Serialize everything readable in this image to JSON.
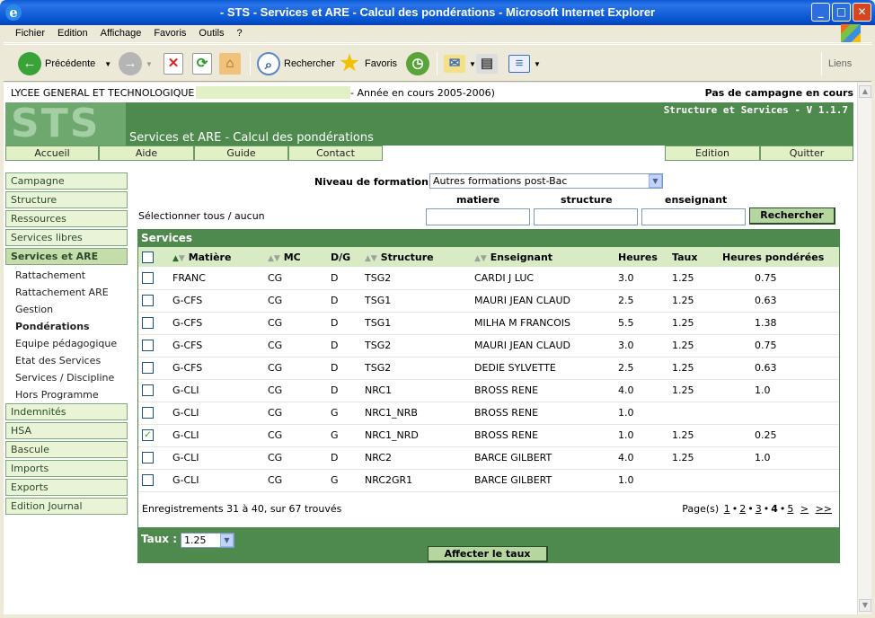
{
  "window": {
    "title": "- STS - Services et ARE - Calcul des pondérations - Microsoft Internet Explorer"
  },
  "menu": [
    "Fichier",
    "Edition",
    "Affichage",
    "Favoris",
    "Outils",
    "?"
  ],
  "toolbar": {
    "back": "Précédente",
    "search": "Rechercher",
    "favorites": "Favoris",
    "links": "Liens"
  },
  "header": {
    "school": "LYCEE GENERAL ET TECHNOLOGIQUE",
    "year": "- Année en cours 2005-2006)",
    "campaign": "Pas de campagne en cours"
  },
  "banner": {
    "logo": "STS",
    "version": "Structure et Services - V 1.1.7",
    "title": "Services et ARE - Calcul des pondérations"
  },
  "navtabs": [
    "Accueil",
    "Aide",
    "Guide",
    "Contact",
    "Edition",
    "Quitter"
  ],
  "sidebar": {
    "top": [
      "Campagne",
      "Structure",
      "Ressources",
      "Services libres",
      "Services et ARE"
    ],
    "sub": [
      "Rattachement",
      "Rattachement ARE",
      "Gestion",
      "Pondérations",
      "Equipe pédagogique",
      "Etat des Services",
      "Services / Discipline",
      "Hors Programme"
    ],
    "bottom": [
      "Indemnités",
      "HSA",
      "Bascule",
      "Imports",
      "Exports",
      "Edition Journal"
    ]
  },
  "filter": {
    "niveau_label": "Niveau de formation :",
    "niveau_value": "Autres formations post-Bac",
    "col_matiere": "matiere",
    "col_structure": "structure",
    "col_enseignant": "enseignant",
    "select_label": "Sélectionner",
    "select_all": "tous",
    "select_sep": "/",
    "select_none": "aucun",
    "search_button": "Rechercher"
  },
  "services": {
    "title": "Services",
    "headers": [
      "Matière",
      "MC",
      "D/G",
      "Structure",
      "Enseignant",
      "Heures",
      "Taux",
      "Heures pondérées"
    ],
    "rows": [
      [
        "FRANC",
        "CG",
        "D",
        "TSG2",
        "CARDI J LUC",
        "3.0",
        "1.25",
        "0.75",
        false
      ],
      [
        "G-CFS",
        "CG",
        "D",
        "TSG1",
        "MAURI JEAN CLAUD",
        "2.5",
        "1.25",
        "0.63",
        false
      ],
      [
        "G-CFS",
        "CG",
        "D",
        "TSG1",
        "MILHA M FRANCOIS",
        "5.5",
        "1.25",
        "1.38",
        false
      ],
      [
        "G-CFS",
        "CG",
        "D",
        "TSG2",
        "MAURI JEAN CLAUD",
        "3.0",
        "1.25",
        "0.75",
        false
      ],
      [
        "G-CFS",
        "CG",
        "D",
        "TSG2",
        "DEDIE SYLVETTE",
        "2.5",
        "1.25",
        "0.63",
        false
      ],
      [
        "G-CLI",
        "CG",
        "D",
        "NRC1",
        "BROSS RENE",
        "4.0",
        "1.25",
        "1.0",
        false
      ],
      [
        "G-CLI",
        "CG",
        "G",
        "NRC1_NRB",
        "BROSS RENE",
        "1.0",
        "",
        "",
        false
      ],
      [
        "G-CLI",
        "CG",
        "G",
        "NRC1_NRD",
        "BROSS RENE",
        "1.0",
        "1.25",
        "0.25",
        true
      ],
      [
        "G-CLI",
        "CG",
        "D",
        "NRC2",
        "BARCE GILBERT",
        "4.0",
        "1.25",
        "1.0",
        false
      ],
      [
        "G-CLI",
        "CG",
        "G",
        "NRC2GR1",
        "BARCE GILBERT",
        "1.0",
        "",
        "",
        false
      ]
    ],
    "records": "Enregistrements 31 à 40, sur 67 trouvés",
    "pages_label": "Page(s)",
    "pages": [
      "1",
      "2",
      "3",
      "4",
      "5",
      ">",
      ">>"
    ],
    "current_page": "4",
    "taux_label": "Taux :",
    "taux_value": "1.25",
    "apply_button": "Affecter le taux"
  },
  "colors": {
    "green": "#4e8a4e",
    "light": "#e2f0c6"
  }
}
